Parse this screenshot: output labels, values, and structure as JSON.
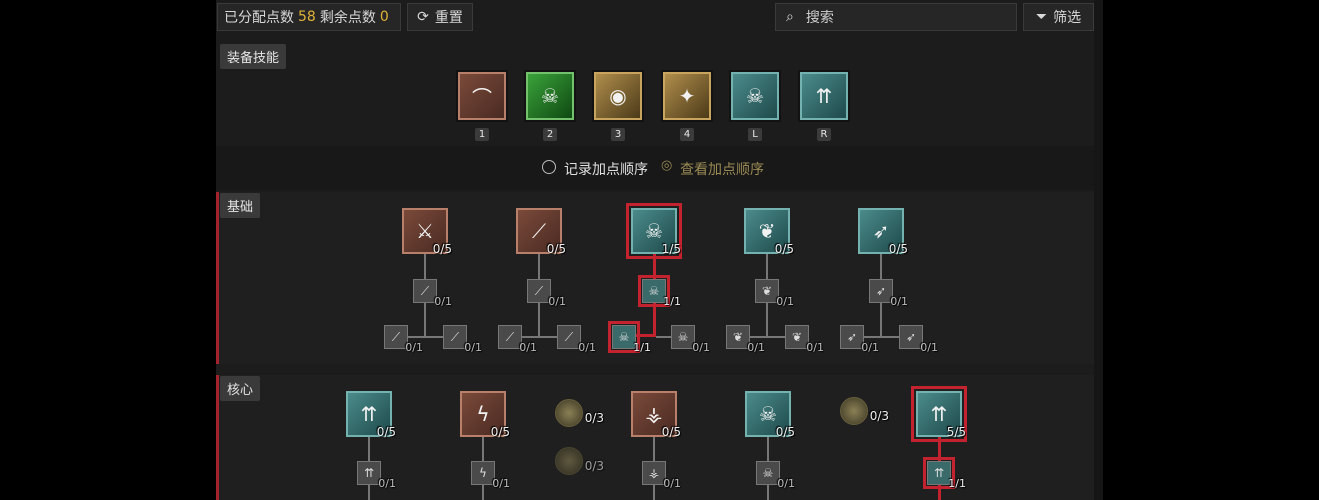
{
  "topbar": {
    "allocated_label": "已分配点数",
    "allocated_value": "58",
    "remaining_label": "剩余点数",
    "remaining_value": "0",
    "reset_label": "重置",
    "search_placeholder": "搜索",
    "filter_label": "筛选"
  },
  "equipped": {
    "title": "装备技能",
    "slots": [
      {
        "key": "1",
        "icon": "hook-blade-icon"
      },
      {
        "key": "2",
        "icon": "poison-skull-icon"
      },
      {
        "key": "3",
        "icon": "eye-smoke-icon"
      },
      {
        "key": "4",
        "icon": "star-burst-icon"
      },
      {
        "key": "L",
        "icon": "skull-sword-icon"
      },
      {
        "key": "R",
        "icon": "arrow-volley-icon"
      }
    ]
  },
  "order": {
    "record_label": "记录加点顺序",
    "view_label": "查看加点顺序"
  },
  "basic": {
    "title": "基础",
    "skills": [
      {
        "count": "0/5"
      },
      {
        "count": "0/5"
      },
      {
        "count": "1/5"
      },
      {
        "count": "0/5"
      },
      {
        "count": "0/5"
      }
    ],
    "upgrades": [
      "0/1",
      "0/1",
      "1/1",
      "0/1",
      "0/1"
    ],
    "branches": [
      "0/1",
      "0/1",
      "0/1",
      "0/1",
      "1/1",
      "0/1",
      "0/1",
      "0/1",
      "0/1",
      "0/1"
    ]
  },
  "core": {
    "title": "核心",
    "skills": [
      "0/5",
      "0/5",
      "0/5",
      "0/5",
      "5/5"
    ],
    "passives": [
      "0/3",
      "0/3",
      "0/3"
    ],
    "upgrades": [
      "0/1",
      "0/1",
      "0/1",
      "0/1",
      "1/1"
    ]
  },
  "colors": {
    "accent_gold": "#e0b23a",
    "selected_red": "#c3232f"
  }
}
